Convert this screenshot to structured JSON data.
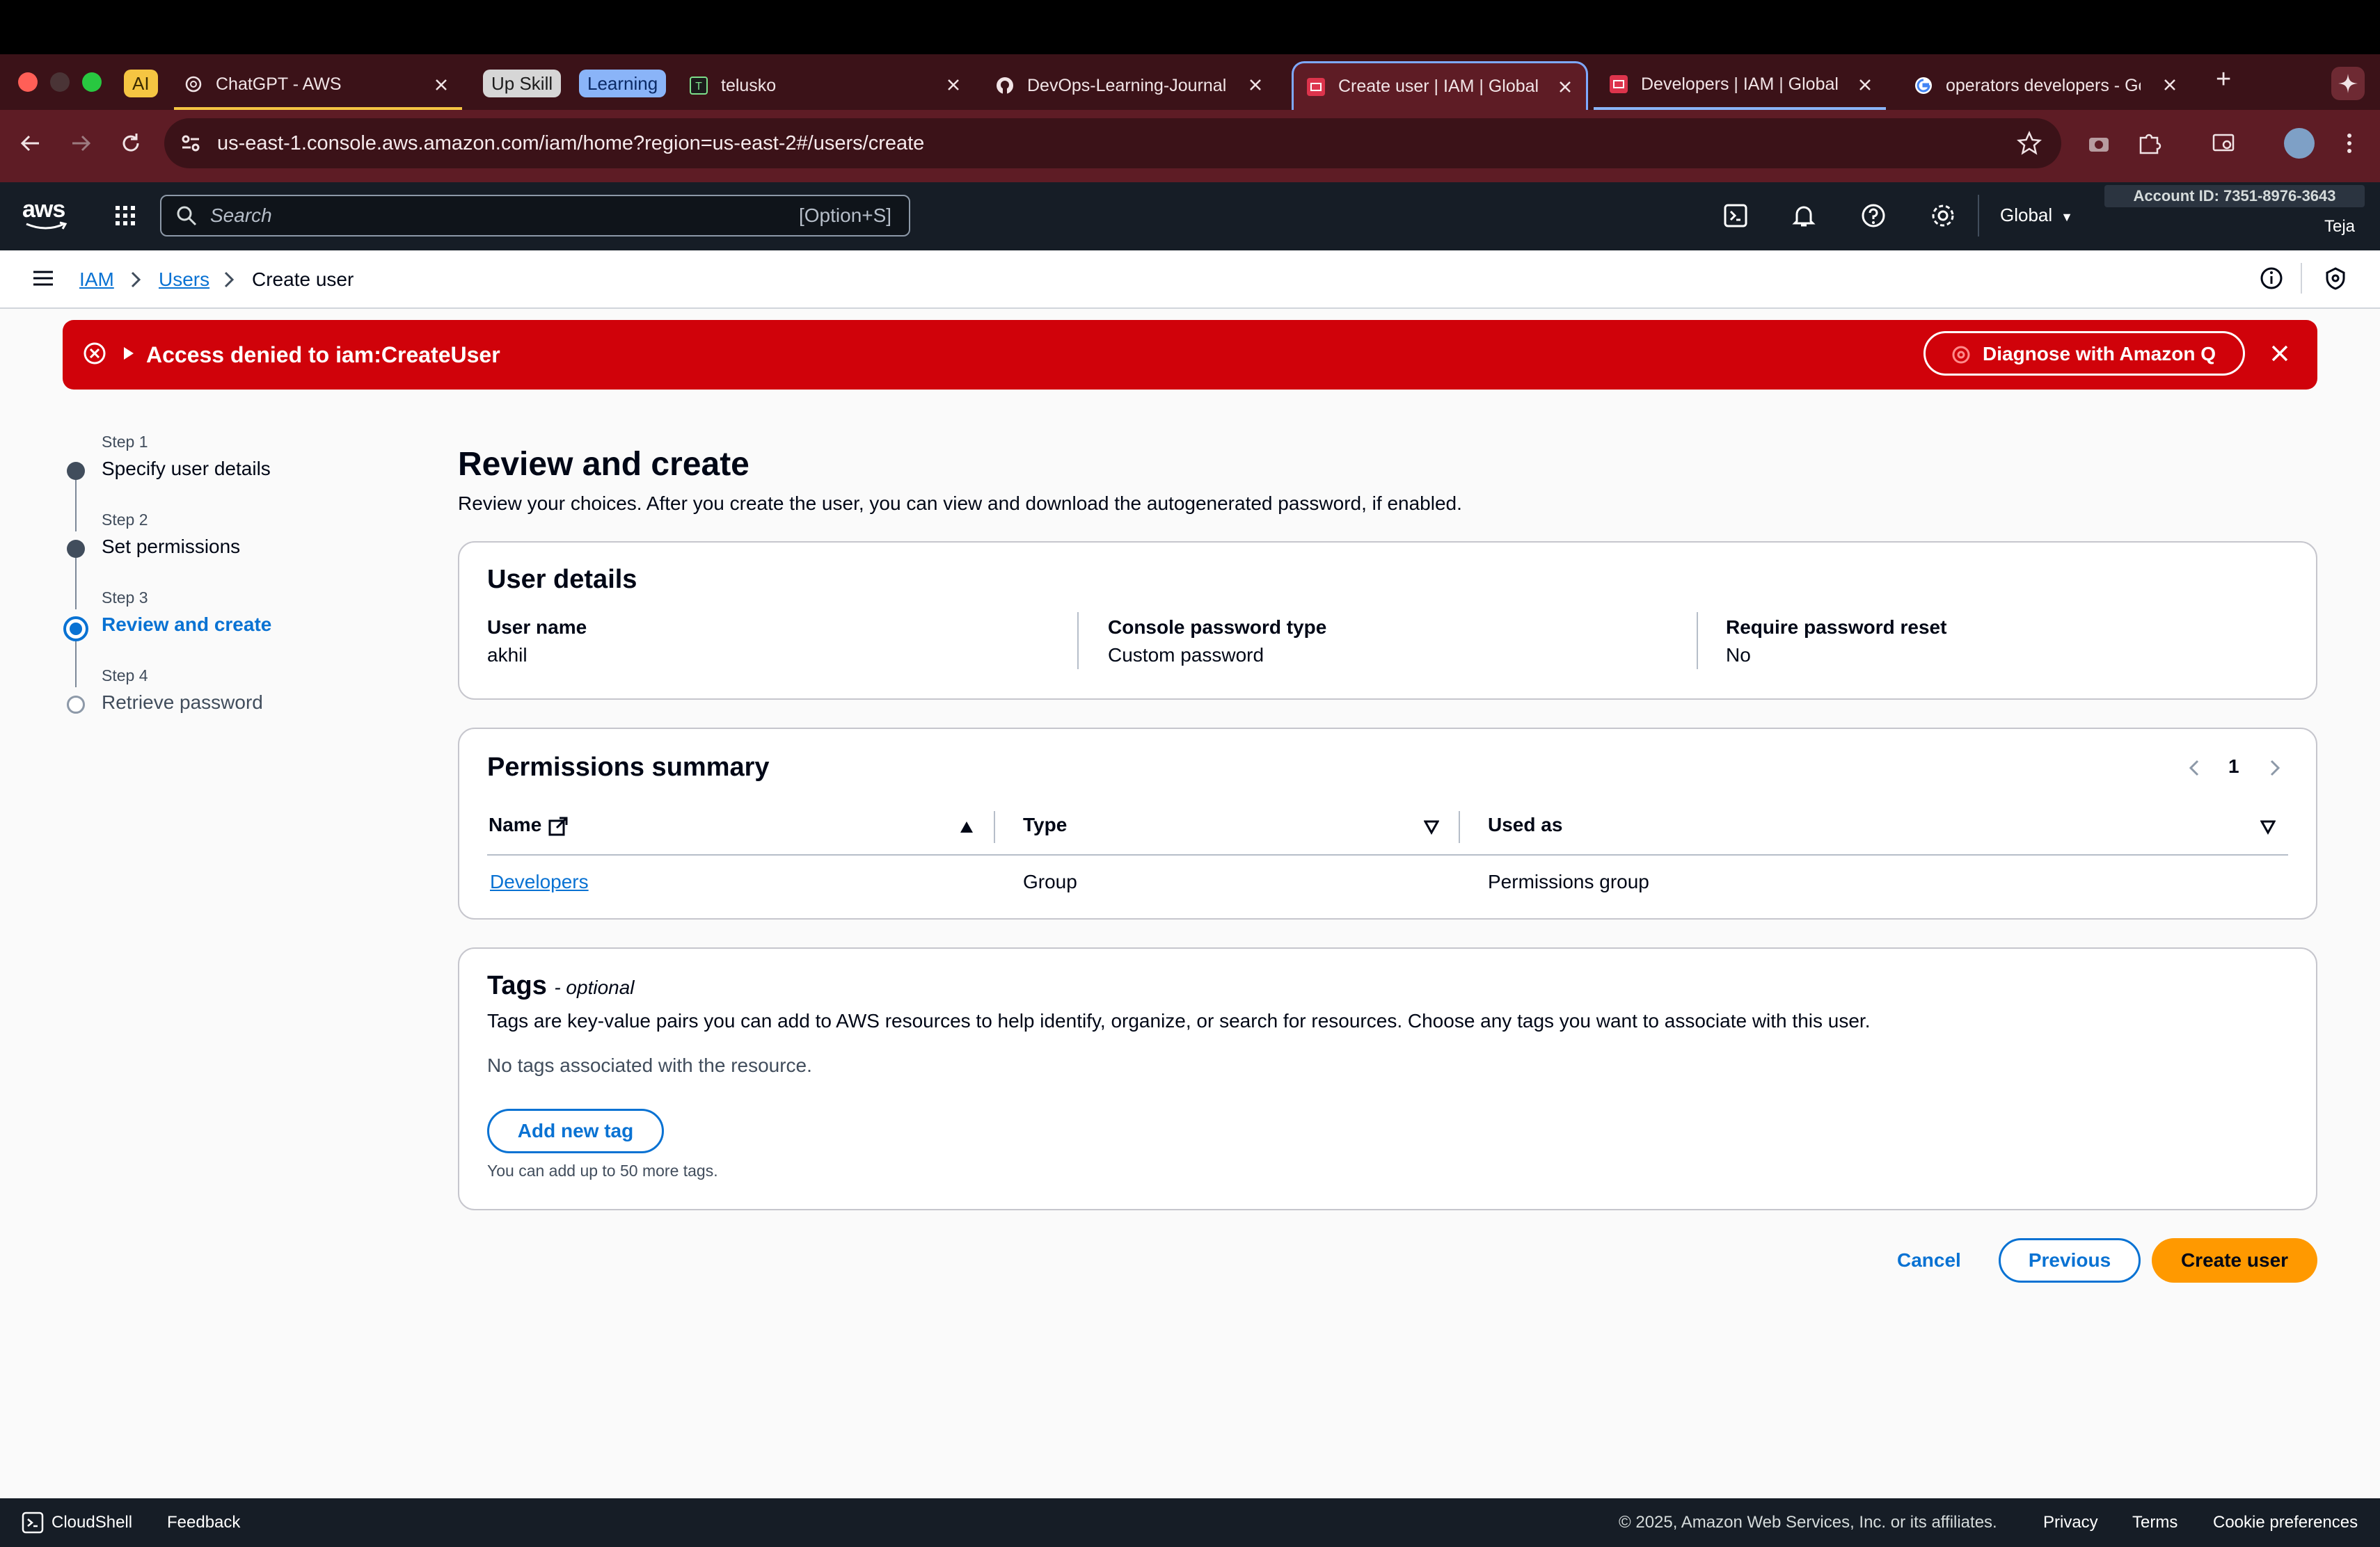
{
  "browser": {
    "chips": {
      "ai": "AI",
      "upskill": "Up Skill",
      "learning": "Learning"
    },
    "tabs": [
      {
        "label": "ChatGPT - AWS"
      },
      {
        "label": "telusko"
      },
      {
        "label": "DevOps-Learning-Journal"
      },
      {
        "label": "Create user | IAM | Global"
      },
      {
        "label": "Developers | IAM | Global"
      },
      {
        "label": "operators developers - Go"
      }
    ],
    "new_tab": "+",
    "url": "us-east-1.console.aws.amazon.com/iam/home?region=us-east-2#/users/create"
  },
  "aws_header": {
    "logo": "aws",
    "search_placeholder": "Search",
    "search_shortcut": "[Option+S]",
    "region": "Global",
    "account_id": "Account ID: 7351-8976-3643",
    "user": "Teja"
  },
  "breadcrumb": {
    "items": [
      "IAM",
      "Users",
      "Create user"
    ]
  },
  "flash": {
    "message": "Access denied to iam:CreateUser",
    "action": "Diagnose with Amazon Q"
  },
  "steps": [
    {
      "step": "Step 1",
      "label": "Specify user details",
      "state": "done"
    },
    {
      "step": "Step 2",
      "label": "Set permissions",
      "state": "done"
    },
    {
      "step": "Step 3",
      "label": "Review and create",
      "state": "current"
    },
    {
      "step": "Step 4",
      "label": "Retrieve password",
      "state": "todo"
    }
  ],
  "main": {
    "title": "Review and create",
    "description": "Review your choices. After you create the user, you can view and download the autogenerated password, if enabled."
  },
  "user_details": {
    "title": "User details",
    "fields": [
      {
        "key": "User name",
        "value": "akhil"
      },
      {
        "key": "Console password type",
        "value": "Custom password"
      },
      {
        "key": "Require password reset",
        "value": "No"
      }
    ]
  },
  "permissions": {
    "title": "Permissions summary",
    "page": "1",
    "columns": [
      "Name",
      "Type",
      "Used as"
    ],
    "rows": [
      {
        "name": "Developers",
        "type": "Group",
        "used_as": "Permissions group"
      }
    ]
  },
  "tags": {
    "title": "Tags",
    "optional": "- optional",
    "description": "Tags are key-value pairs you can add to AWS resources to help identify, organize, or search for resources. Choose any tags you want to associate with this user.",
    "empty": "No tags associated with the resource.",
    "add_button": "Add new tag",
    "hint": "You can add up to 50 more tags."
  },
  "actions": {
    "cancel": "Cancel",
    "previous": "Previous",
    "create": "Create user"
  },
  "footer": {
    "cloudshell": "CloudShell",
    "feedback": "Feedback",
    "copyright": "© 2025, Amazon Web Services, Inc. or its affiliates.",
    "privacy": "Privacy",
    "terms": "Terms",
    "cookies": "Cookie preferences"
  },
  "colors": {
    "error": "#d0020a",
    "link": "#0972d3",
    "primary_button": "#ff9900",
    "header": "#161d26"
  }
}
